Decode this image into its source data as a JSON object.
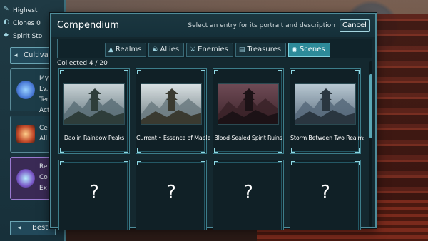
{
  "side_panel": {
    "stats": [
      {
        "icon": "quill-icon",
        "label": "Highest"
      },
      {
        "icon": "clone-icon",
        "label": "Clones 0"
      },
      {
        "icon": "spirit-stone-icon",
        "label": "Spirit Sto"
      }
    ],
    "section_label": "Cultivati",
    "cards": [
      {
        "lines": [
          "My",
          "Lv.",
          "Ter",
          "Act"
        ]
      },
      {
        "lines": [
          "Ce",
          "All"
        ]
      },
      {
        "lines": [
          "Re",
          "Co",
          "Ex"
        ]
      }
    ],
    "bottom_label": "Besti"
  },
  "modal": {
    "title": "Compendium",
    "hint": "Select an entry for its portrait and description",
    "cancel_label": "Cancel",
    "tabs": [
      {
        "label": "Realms",
        "icon": "mountain-icon",
        "active": false
      },
      {
        "label": "Allies",
        "icon": "allies-icon",
        "active": false
      },
      {
        "label": "Enemies",
        "icon": "sword-icon",
        "active": false
      },
      {
        "label": "Treasures",
        "icon": "scroll-icon",
        "active": false
      },
      {
        "label": "Scenes",
        "icon": "scene-icon",
        "active": true
      }
    ],
    "collected": "Collected 4 / 20",
    "entries": [
      {
        "name": "Dao in Rainbow Peaks",
        "locked": false,
        "palette": [
          "#c9d3d6",
          "#5b6e77",
          "#2e3d3a"
        ]
      },
      {
        "name": "Current • Essence of Maple",
        "locked": false,
        "palette": [
          "#d9e0e2",
          "#6b7a80",
          "#3a3a30"
        ]
      },
      {
        "name": "Blood-Sealed Spirit Ruins",
        "locked": false,
        "palette": [
          "#6e4a55",
          "#3a2228",
          "#1c1216"
        ]
      },
      {
        "name": "Storm Between Two Realms",
        "locked": false,
        "palette": [
          "#b8c8d2",
          "#56687a",
          "#2a3640"
        ]
      },
      {
        "name": "",
        "locked": true,
        "mark": "?"
      },
      {
        "name": "",
        "locked": true,
        "mark": "?"
      },
      {
        "name": "",
        "locked": true,
        "mark": "?"
      },
      {
        "name": "",
        "locked": true,
        "mark": "?"
      }
    ]
  }
}
